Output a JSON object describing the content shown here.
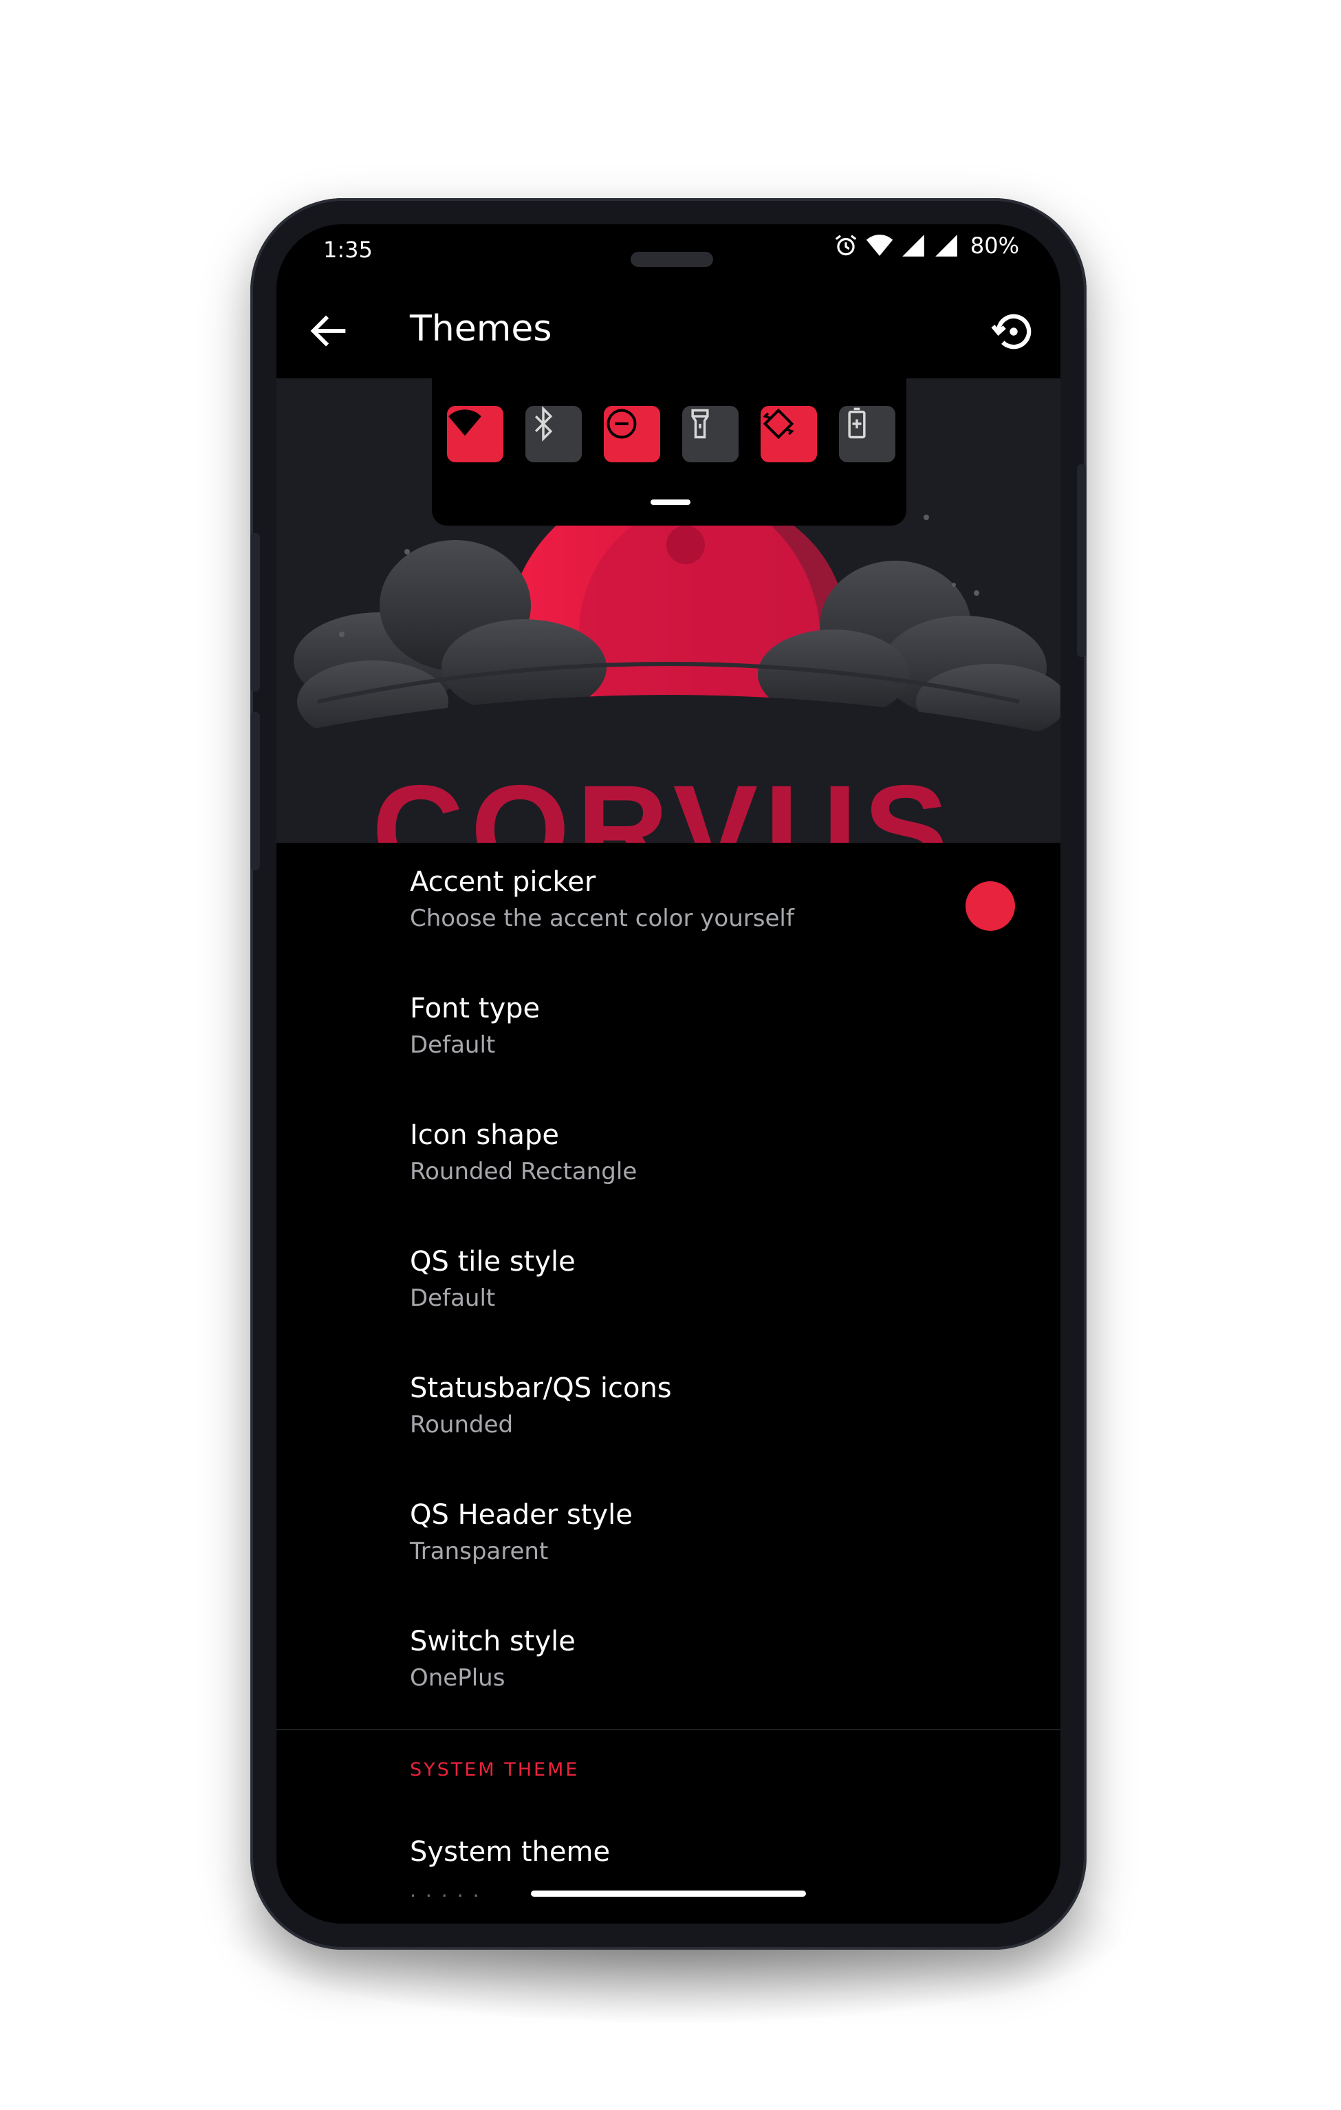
{
  "status_bar": {
    "time": "1:35",
    "battery": "80%"
  },
  "app_bar": {
    "title": "Themes"
  },
  "hero": {
    "logo_text": "CORVUS",
    "qs_tiles": [
      {
        "icon": "wifi-icon",
        "state": "on"
      },
      {
        "icon": "bluetooth-icon",
        "state": "off"
      },
      {
        "icon": "do-not-disturb-icon",
        "state": "on"
      },
      {
        "icon": "flashlight-icon",
        "state": "off"
      },
      {
        "icon": "auto-rotate-icon",
        "state": "on"
      },
      {
        "icon": "battery-saver-icon",
        "state": "off"
      }
    ]
  },
  "preferences": [
    {
      "title": "Accent picker",
      "summary": "Choose the accent color yourself"
    },
    {
      "title": "Font type",
      "summary": "Default"
    },
    {
      "title": "Icon shape",
      "summary": "Rounded Rectangle"
    },
    {
      "title": "QS tile style",
      "summary": "Default"
    },
    {
      "title": "Statusbar/QS icons",
      "summary": "Rounded"
    },
    {
      "title": "QS Header style",
      "summary": "Transparent"
    },
    {
      "title": "Switch style",
      "summary": "OnePlus"
    }
  ],
  "system_theme_section": {
    "header": "SYSTEM THEME",
    "items": [
      {
        "title": "System theme"
      }
    ]
  },
  "colors": {
    "accent": "#e8233d",
    "background": "#000000",
    "frame": "#15171d"
  }
}
